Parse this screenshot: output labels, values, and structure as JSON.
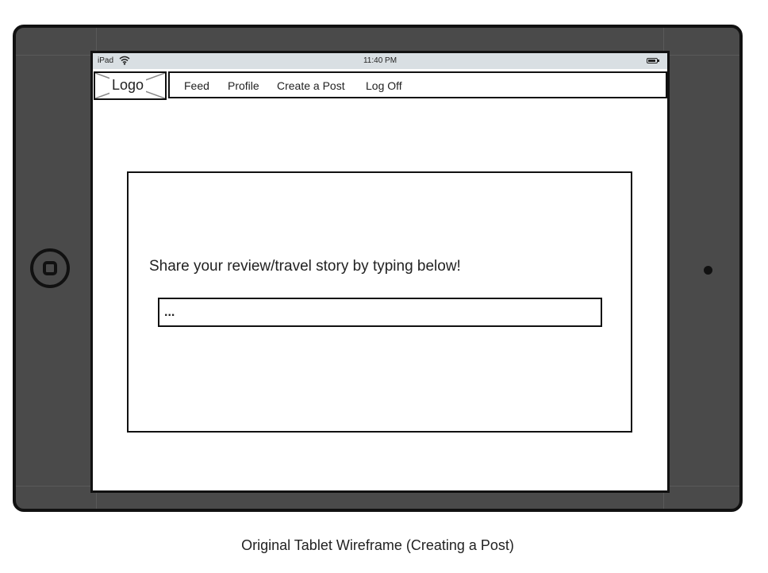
{
  "status_bar": {
    "carrier": "iPad",
    "wifi_icon": "wifi-icon",
    "time": "11:40 PM",
    "battery_icon": "battery-icon"
  },
  "header": {
    "logo_label": "Logo",
    "nav_items": [
      "Feed",
      "Profile",
      "Create a Post",
      "Log Off"
    ]
  },
  "main": {
    "prompt": "Share your review/travel story by typing below!",
    "input_placeholder": "..."
  },
  "caption": "Original Tablet Wireframe (Creating a Post)",
  "colors": {
    "device_frame": "#4a4a4a",
    "outline": "#111111",
    "status_bar": "#d9dfe3",
    "screen": "#ffffff"
  }
}
